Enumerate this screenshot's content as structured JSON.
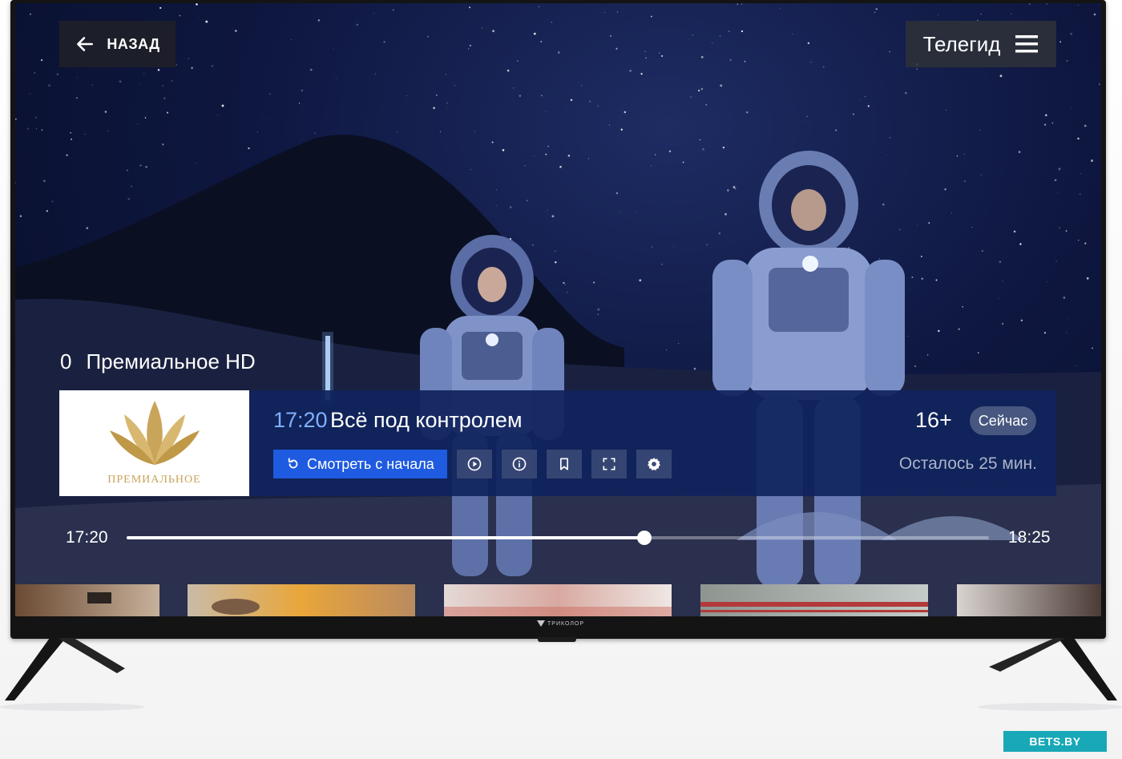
{
  "header": {
    "back_label": "НАЗАД",
    "back_icon": "arrow-left-icon",
    "guide_label": "Телегид",
    "guide_icon": "hamburger-menu-icon"
  },
  "channel": {
    "number": "0",
    "name": "Премиальное HD",
    "logo_text": "ПРЕМИАЛЬНОЕ"
  },
  "program": {
    "start_time": "17:20",
    "title": "Всё под контролем",
    "age_rating": "16+",
    "status_badge": "Сейчас",
    "remaining": "Осталось 25 мин."
  },
  "actions": {
    "watch_from_start": "Смотреть с начала",
    "icons": [
      "play-circle-icon",
      "info-icon",
      "bookmark-icon",
      "fullscreen-icon",
      "gear-icon"
    ]
  },
  "progress": {
    "start": "17:20",
    "end": "18:25",
    "fraction": 0.6
  },
  "tv": {
    "brand": "ТРИКОЛОР"
  },
  "watermark": "BETS.BY",
  "colors": {
    "accent_blue": "#1f5be0",
    "time_blue": "#7fb0ff",
    "panel": "#10235c",
    "logo_gold": "#c9a45b",
    "watermark": "#18a8b7"
  }
}
